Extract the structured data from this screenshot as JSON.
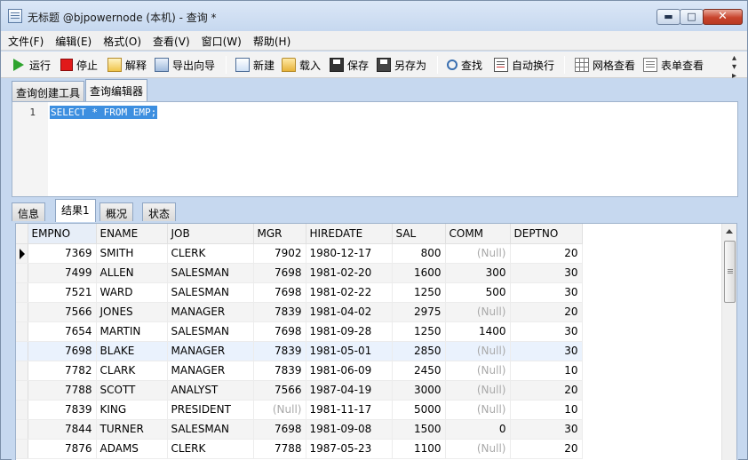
{
  "window": {
    "title": "无标题 @bjpowernode (本机) - 查询 *",
    "buttons": {
      "minimize": "▬",
      "maximize": "□",
      "close": "✕"
    }
  },
  "menu": [
    "文件(F)",
    "编辑(E)",
    "格式(O)",
    "查看(V)",
    "窗口(W)",
    "帮助(H)"
  ],
  "toolbar": {
    "run": "运行",
    "stop": "停止",
    "explain": "解释",
    "export": "导出向导",
    "new": "新建",
    "load": "载入",
    "save": "保存",
    "saveas": "另存为",
    "find": "查找",
    "wrap": "自动换行",
    "grid_view": "网格查看",
    "form_view": "表单查看",
    "more": "▸"
  },
  "editor_tabs": [
    "查询创建工具",
    "查询编辑器"
  ],
  "editor": {
    "line": "1",
    "sql": "SELECT * FROM EMP;"
  },
  "result_tabs": [
    "信息",
    "结果1",
    "概况",
    "状态"
  ],
  "grid": {
    "columns": [
      "EMPNO",
      "ENAME",
      "JOB",
      "MGR",
      "HIREDATE",
      "SAL",
      "COMM",
      "DEPTNO"
    ],
    "rows": [
      [
        "7369",
        "SMITH",
        "CLERK",
        "7902",
        "1980-12-17",
        "800",
        "(Null)",
        "20"
      ],
      [
        "7499",
        "ALLEN",
        "SALESMAN",
        "7698",
        "1981-02-20",
        "1600",
        "300",
        "30"
      ],
      [
        "7521",
        "WARD",
        "SALESMAN",
        "7698",
        "1981-02-22",
        "1250",
        "500",
        "30"
      ],
      [
        "7566",
        "JONES",
        "MANAGER",
        "7839",
        "1981-04-02",
        "2975",
        "(Null)",
        "20"
      ],
      [
        "7654",
        "MARTIN",
        "SALESMAN",
        "7698",
        "1981-09-28",
        "1250",
        "1400",
        "30"
      ],
      [
        "7698",
        "BLAKE",
        "MANAGER",
        "7839",
        "1981-05-01",
        "2850",
        "(Null)",
        "30"
      ],
      [
        "7782",
        "CLARK",
        "MANAGER",
        "7839",
        "1981-06-09",
        "2450",
        "(Null)",
        "10"
      ],
      [
        "7788",
        "SCOTT",
        "ANALYST",
        "7566",
        "1987-04-19",
        "3000",
        "(Null)",
        "20"
      ],
      [
        "7839",
        "KING",
        "PRESIDENT",
        "(Null)",
        "1981-11-17",
        "5000",
        "(Null)",
        "10"
      ],
      [
        "7844",
        "TURNER",
        "SALESMAN",
        "7698",
        "1981-09-08",
        "1500",
        "0",
        "30"
      ],
      [
        "7876",
        "ADAMS",
        "CLERK",
        "7788",
        "1987-05-23",
        "1100",
        "(Null)",
        "20"
      ]
    ]
  }
}
